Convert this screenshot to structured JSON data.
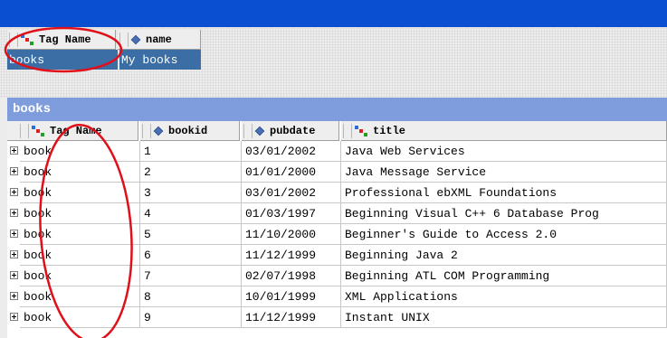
{
  "root_table": {
    "columns": [
      {
        "label": "Tag Name",
        "icon": "tag-icon"
      },
      {
        "label": "name",
        "icon": "attribute-icon"
      }
    ],
    "row": {
      "tag": "books",
      "name": "My books"
    }
  },
  "section": {
    "title": "books"
  },
  "grid": {
    "columns": [
      {
        "label": "Tag Name",
        "icon": "tag-icon"
      },
      {
        "label": "bookid",
        "icon": "attribute-icon"
      },
      {
        "label": "pubdate",
        "icon": "attribute-icon"
      },
      {
        "label": "title",
        "icon": "tag-icon"
      }
    ],
    "rows": [
      {
        "tag": "book",
        "bookid": "1",
        "pubdate": "03/01/2002",
        "title": "Java Web Services"
      },
      {
        "tag": "book",
        "bookid": "2",
        "pubdate": "01/01/2000",
        "title": "Java Message Service"
      },
      {
        "tag": "book",
        "bookid": "3",
        "pubdate": "03/01/2002",
        "title": "Professional ebXML Foundations"
      },
      {
        "tag": "book",
        "bookid": "4",
        "pubdate": "01/03/1997",
        "title": "Beginning Visual C++ 6 Database Prog"
      },
      {
        "tag": "book",
        "bookid": "5",
        "pubdate": "11/10/2000",
        "title": "Beginner's Guide to Access 2.0"
      },
      {
        "tag": "book",
        "bookid": "6",
        "pubdate": "11/12/1999",
        "title": "Beginning Java 2"
      },
      {
        "tag": "book",
        "bookid": "7",
        "pubdate": "02/07/1998",
        "title": "Beginning ATL COM Programming"
      },
      {
        "tag": "book",
        "bookid": "8",
        "pubdate": "10/01/1999",
        "title": "XML Applications"
      },
      {
        "tag": "book",
        "bookid": "9",
        "pubdate": "11/12/1999",
        "title": "Instant UNIX"
      }
    ]
  },
  "colors": {
    "titlebar": "#0a4fd0",
    "section": "#7f9ddc",
    "selection": "#3a6ea5",
    "annotation": "#e0101a"
  }
}
